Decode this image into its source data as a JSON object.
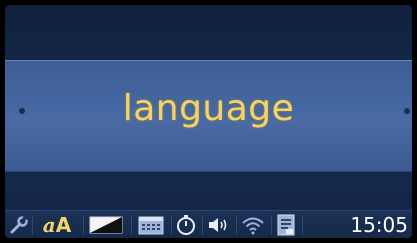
{
  "menu": {
    "title": "language"
  },
  "status_bar": {
    "icons": [
      "wrench-icon",
      "font-size-icon",
      "brightness-icon",
      "calendar-icon",
      "timer-icon",
      "speaker-icon",
      "wifi-icon",
      "notes-icon"
    ],
    "font_size_label_small": "a",
    "font_size_label_big": "A",
    "time": "15:05"
  },
  "colors": {
    "accent": "#f2d46a",
    "band": "#4668a2",
    "background": "#13264a"
  }
}
